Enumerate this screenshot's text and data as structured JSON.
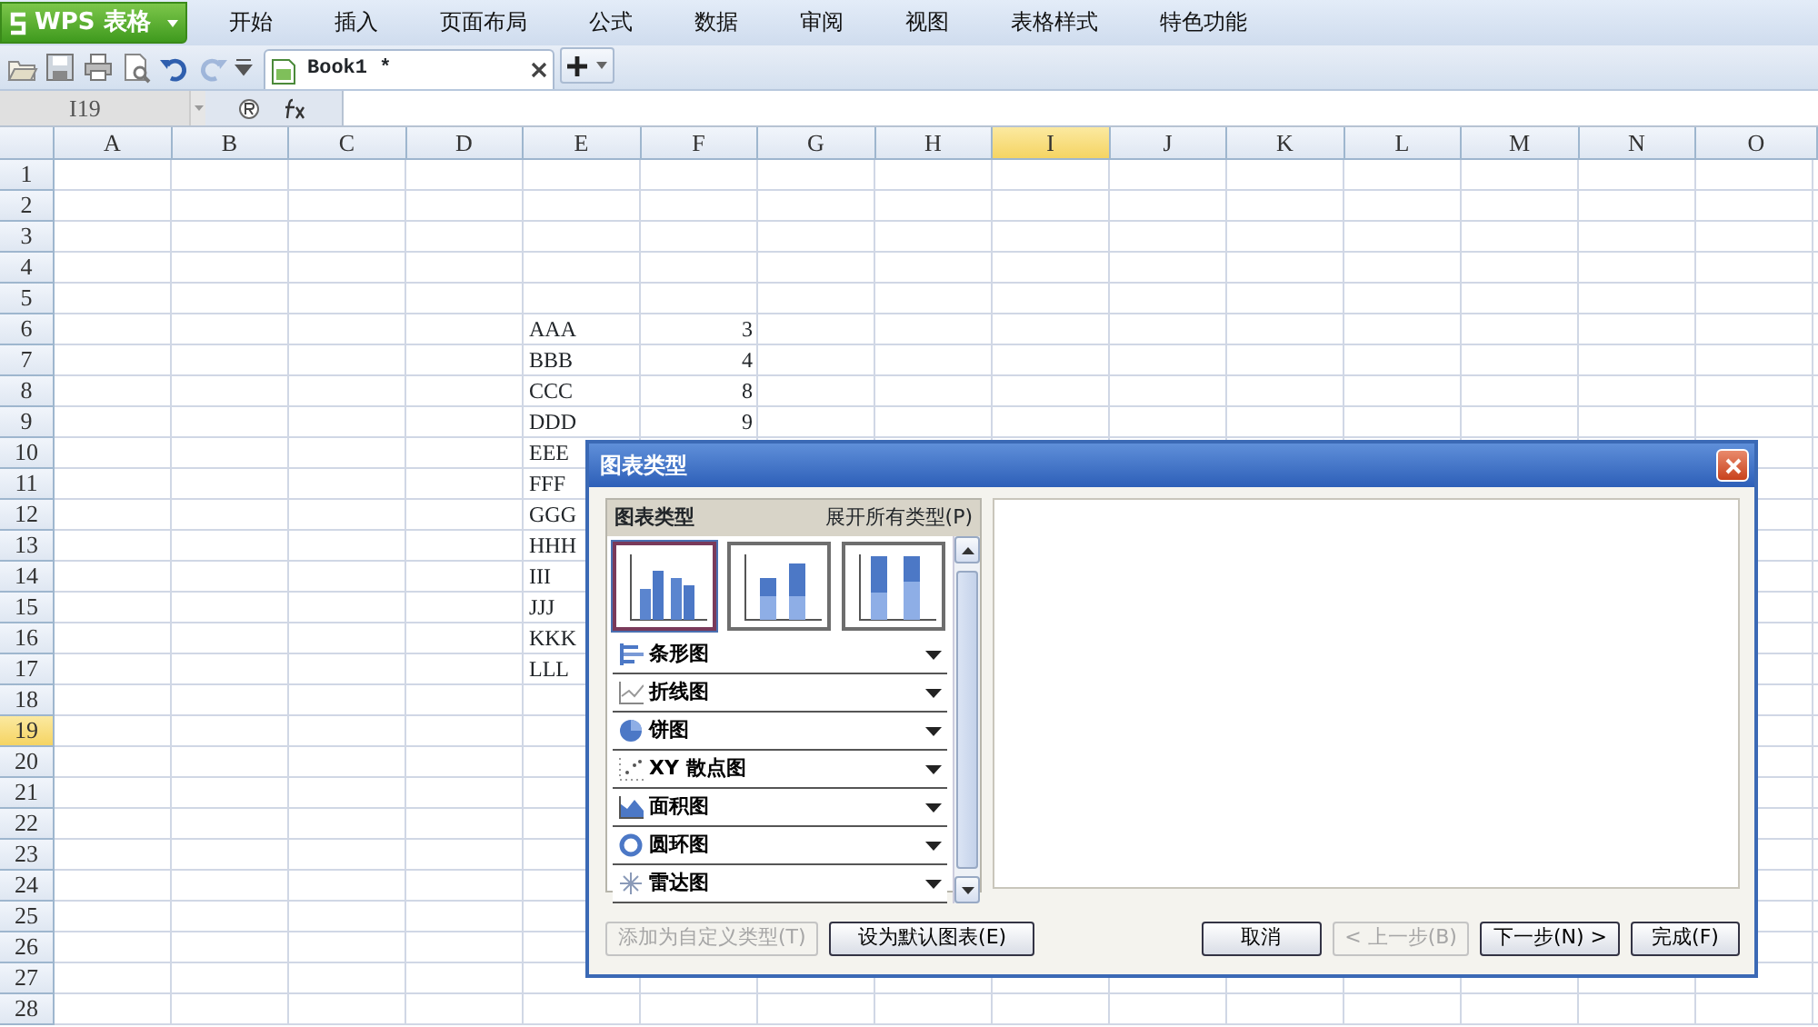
{
  "app": {
    "logo": "WPS 表格"
  },
  "menu": [
    "开始",
    "插入",
    "页面布局",
    "公式",
    "数据",
    "审阅",
    "视图",
    "表格样式",
    "特色功能"
  ],
  "toolbar": {
    "buttons": [
      {
        "kind": "open",
        "disabled": false
      },
      {
        "kind": "save",
        "disabled": false
      },
      {
        "kind": "print",
        "disabled": false
      },
      {
        "kind": "preview",
        "disabled": false
      },
      {
        "kind": "undo",
        "disabled": false
      },
      {
        "kind": "redo",
        "disabled": true
      }
    ],
    "document_tab": {
      "title": "Book1 *",
      "selected": true
    }
  },
  "formula_bar": {
    "name_box": "I19"
  },
  "sheet": {
    "columns": [
      {
        "label": "A",
        "selected": false
      },
      {
        "label": "B",
        "selected": false
      },
      {
        "label": "C",
        "selected": false
      },
      {
        "label": "D",
        "selected": false
      },
      {
        "label": "E",
        "selected": false
      },
      {
        "label": "F",
        "selected": false
      },
      {
        "label": "G",
        "selected": false
      },
      {
        "label": "H",
        "selected": false
      },
      {
        "label": "I",
        "selected": true
      },
      {
        "label": "J",
        "selected": false
      },
      {
        "label": "K",
        "selected": false
      },
      {
        "label": "L",
        "selected": false
      },
      {
        "label": "M",
        "selected": false
      },
      {
        "label": "N",
        "selected": false
      },
      {
        "label": "O",
        "selected": false
      }
    ],
    "rows": [
      {
        "label": "1",
        "selected": false
      },
      {
        "label": "2",
        "selected": false
      },
      {
        "label": "3",
        "selected": false
      },
      {
        "label": "4",
        "selected": false
      },
      {
        "label": "5",
        "selected": false
      },
      {
        "label": "6",
        "selected": false,
        "column_e": {
          "text": "AAA"
        },
        "column_f": {
          "text": "3",
          "kind": "number"
        }
      },
      {
        "label": "7",
        "selected": false,
        "column_e": {
          "text": "BBB"
        },
        "column_f": {
          "text": "4",
          "kind": "number"
        }
      },
      {
        "label": "8",
        "selected": false,
        "column_e": {
          "text": "CCC"
        },
        "column_f": {
          "text": "8",
          "kind": "number"
        }
      },
      {
        "label": "9",
        "selected": false,
        "column_e": {
          "text": "DDD"
        },
        "column_f": {
          "text": "9",
          "kind": "number"
        }
      },
      {
        "label": "10",
        "selected": false,
        "column_e": {
          "text": "EEE"
        }
      },
      {
        "label": "11",
        "selected": false,
        "column_e": {
          "text": "FFF"
        }
      },
      {
        "label": "12",
        "selected": false,
        "column_e": {
          "text": "GGG"
        }
      },
      {
        "label": "13",
        "selected": false,
        "column_e": {
          "text": "HHH"
        }
      },
      {
        "label": "14",
        "selected": false,
        "column_e": {
          "text": "III"
        }
      },
      {
        "label": "15",
        "selected": false,
        "column_e": {
          "text": "JJJ"
        }
      },
      {
        "label": "16",
        "selected": false,
        "column_e": {
          "text": "KKK"
        }
      },
      {
        "label": "17",
        "selected": false,
        "column_e": {
          "text": "LLL"
        }
      },
      {
        "label": "18",
        "selected": false
      },
      {
        "label": "19",
        "selected": true
      },
      {
        "label": "20",
        "selected": false
      },
      {
        "label": "21",
        "selected": false
      },
      {
        "label": "22",
        "selected": false
      },
      {
        "label": "23",
        "selected": false
      },
      {
        "label": "24",
        "selected": false
      },
      {
        "label": "25",
        "selected": false
      },
      {
        "label": "26",
        "selected": false
      },
      {
        "label": "27",
        "selected": false
      },
      {
        "label": "28",
        "selected": false
      }
    ]
  },
  "dialog": {
    "title": "图表类型",
    "panel_title": "图表类型",
    "expand_link": "展开所有类型(P)",
    "subtypes": [
      {
        "kind": "clustered",
        "selected": true
      },
      {
        "kind": "stacked",
        "selected": false
      },
      {
        "kind": "percent",
        "selected": false
      }
    ],
    "categories": [
      {
        "label": "条形图",
        "kind": "bar"
      },
      {
        "label": "折线图",
        "kind": "line"
      },
      {
        "label": "饼图",
        "kind": "pie"
      },
      {
        "label": "XY 散点图",
        "kind": "scatter"
      },
      {
        "label": "面积图",
        "kind": "area"
      },
      {
        "label": "圆环图",
        "kind": "doughnut"
      },
      {
        "label": "雷达图",
        "kind": "radar"
      }
    ],
    "buttons_left": [
      {
        "label": "添加为自定义类型(T)",
        "disabled": true
      },
      {
        "label": "设为默认图表(E)",
        "disabled": false
      }
    ],
    "buttons_right": [
      {
        "label": "取消",
        "disabled": false
      },
      {
        "label": "< 上一步(B)",
        "disabled": true
      },
      {
        "label": "下一步(N) >",
        "disabled": false
      },
      {
        "label": "完成(F)",
        "disabled": false
      }
    ]
  }
}
